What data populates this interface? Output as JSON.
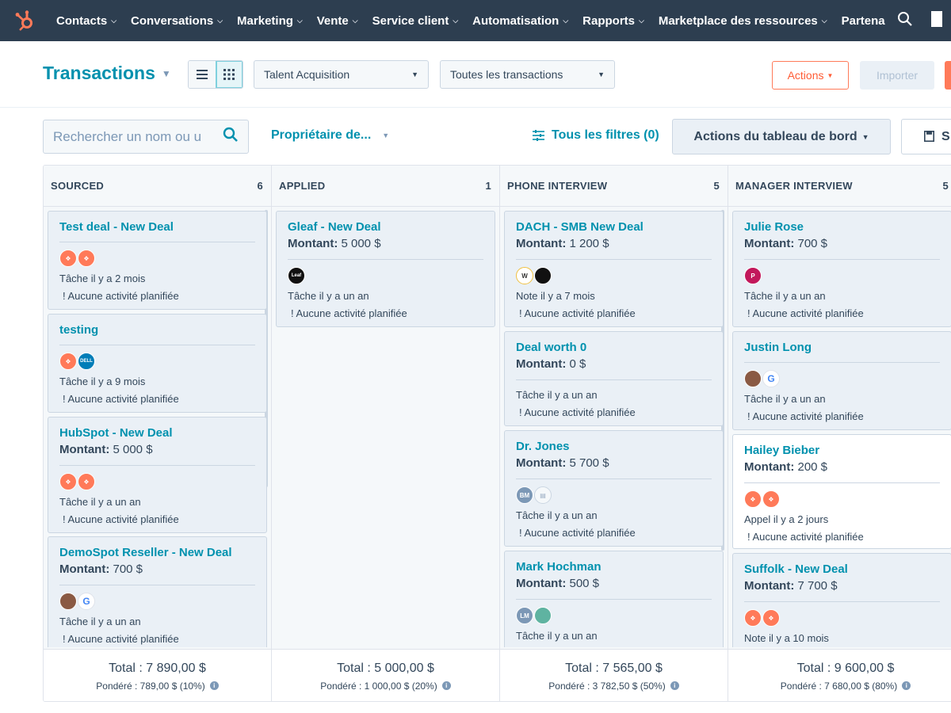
{
  "nav": {
    "logo": "hubspot-sprocket",
    "items": [
      {
        "label": "Contacts"
      },
      {
        "label": "Conversations"
      },
      {
        "label": "Marketing"
      },
      {
        "label": "Vente"
      },
      {
        "label": "Service client"
      },
      {
        "label": "Automatisation"
      },
      {
        "label": "Rapports"
      },
      {
        "label": "Marketplace des ressources"
      },
      {
        "label": "Partena"
      }
    ],
    "search_icon": "search-icon"
  },
  "header": {
    "title": "Transactions",
    "pipeline_select": "Talent Acquisition",
    "view_select": "Toutes les transactions",
    "actions_label": "Actions",
    "import_label": "Importer"
  },
  "filters": {
    "search_placeholder": "Rechercher un nom ou u",
    "owner_label": "Propriétaire de...",
    "all_filters_label": "Tous les filtres (0)",
    "board_actions_label": "Actions du tableau de bord",
    "save_label": "S"
  },
  "columns": [
    {
      "name": "SOURCED",
      "count": "6",
      "total": "Total : 7 890,00 $",
      "weighted": "Pondéré : 789,00 $ (10%)",
      "cards": [
        {
          "title": "Test deal - New Deal",
          "activity": "Tâche il y a 2 mois",
          "noact": "! Aucune activité planifiée"
        },
        {
          "title": "testing",
          "activity": "Tâche il y a 9 mois",
          "noact": "! Aucune activité planifiée"
        },
        {
          "title": "HubSpot - New Deal",
          "amount_label": "Montant:",
          "amount_value": "5 000 $",
          "activity": "Tâche il y a un an",
          "noact": "! Aucune activité planifiée"
        },
        {
          "title": "DemoSpot Reseller - New Deal",
          "amount_label": "Montant:",
          "amount_value": "700 $",
          "activity": "Tâche il y a un an",
          "noact": "! Aucune activité planifiée"
        }
      ]
    },
    {
      "name": "APPLIED",
      "count": "1",
      "total": "Total : 5 000,00 $",
      "weighted": "Pondéré : 1 000,00 $ (20%)",
      "cards": [
        {
          "title": "Gleaf - New Deal",
          "amount_label": "Montant:",
          "amount_value": "5 000 $",
          "avatar_text": "Leaf",
          "activity": "Tâche il y a un an",
          "noact": "! Aucune activité planifiée"
        }
      ]
    },
    {
      "name": "PHONE INTERVIEW",
      "count": "5",
      "total": "Total : 7 565,00 $",
      "weighted": "Pondéré : 3 782,50 $ (50%)",
      "cards": [
        {
          "title": "DACH - SMB New Deal",
          "amount_label": "Montant:",
          "amount_value": "1 200 $",
          "activity": "Note il y a 7 mois",
          "noact": "! Aucune activité planifiée"
        },
        {
          "title": "Deal worth 0",
          "amount_label": "Montant:",
          "amount_value": "0 $",
          "activity": "Tâche il y a un an",
          "noact": "! Aucune activité planifiée"
        },
        {
          "title": "Dr. Jones",
          "amount_label": "Montant:",
          "amount_value": "5 700 $",
          "avatar_text": "BM",
          "activity": "Tâche il y a un an",
          "noact": "! Aucune activité planifiée"
        },
        {
          "title": "Mark Hochman",
          "amount_label": "Montant:",
          "amount_value": "500 $",
          "avatar_text": "LM",
          "activity": "Tâche il y a un an"
        }
      ]
    },
    {
      "name": "MANAGER INTERVIEW",
      "count": "5",
      "total": "Total : 9 600,00 $",
      "weighted": "Pondéré : 7 680,00 $ (80%)",
      "cards": [
        {
          "title": "Julie Rose",
          "amount_label": "Montant:",
          "amount_value": "700 $",
          "activity": "Tâche il y a un an",
          "noact": "! Aucune activité planifiée"
        },
        {
          "title": "Justin Long",
          "activity": "Tâche il y a un an",
          "noact": "! Aucune activité planifiée"
        },
        {
          "title": "Hailey Bieber",
          "amount_label": "Montant:",
          "amount_value": "200 $",
          "activity": "Appel il y a 2 jours",
          "noact": "! Aucune activité planifiée"
        },
        {
          "title": "Suffolk - New Deal",
          "amount_label": "Montant:",
          "amount_value": "7 700 $",
          "activity": "Note il y a 10 mois"
        }
      ]
    }
  ],
  "colors": {
    "nav_bg": "#2d3e50",
    "accent_teal": "#0091ae",
    "accent_orange": "#ff7a59",
    "card_bg": "#eaf0f6"
  }
}
